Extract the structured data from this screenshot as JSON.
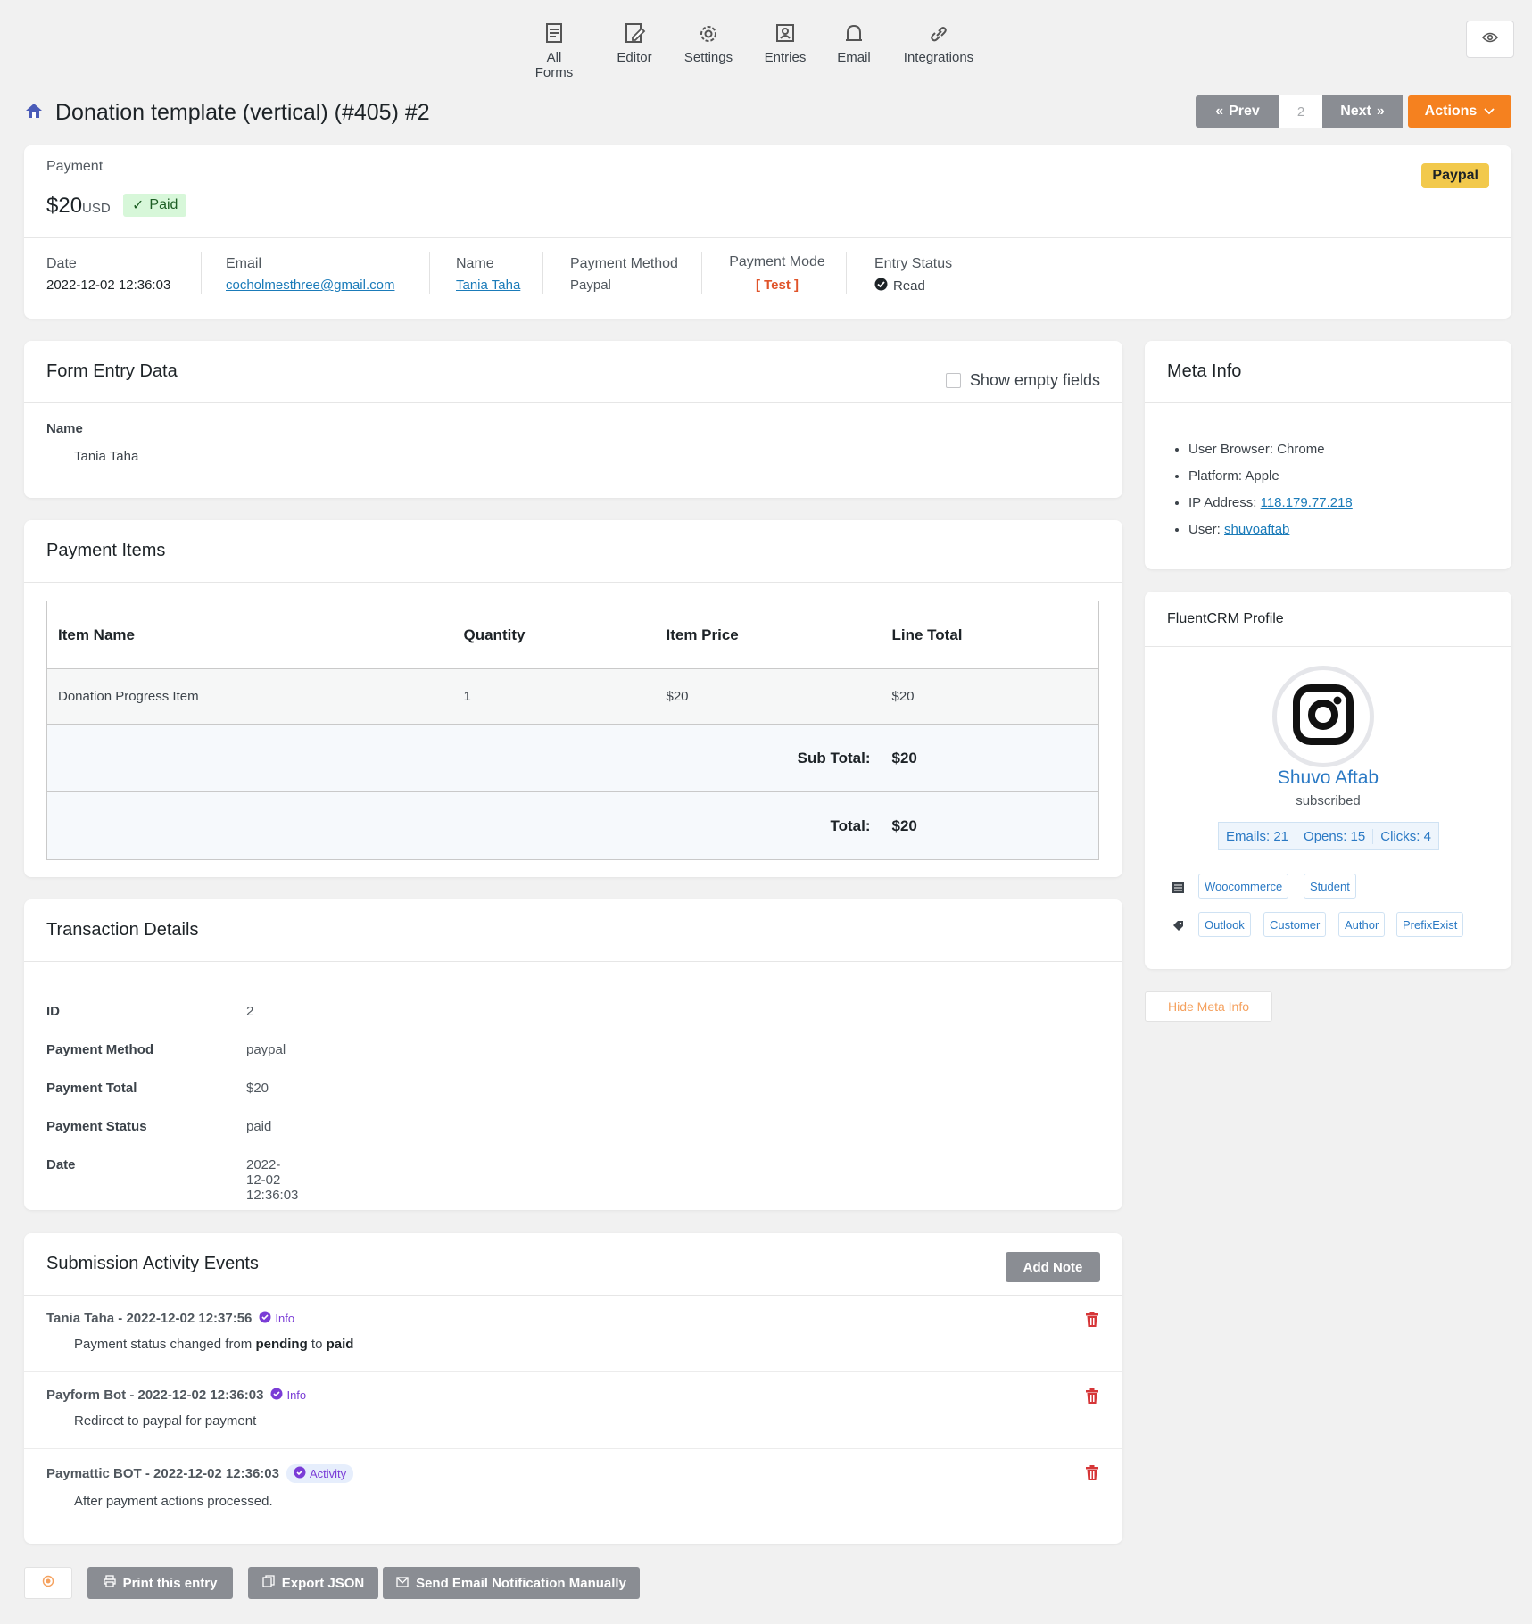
{
  "nav": {
    "items": [
      {
        "label": "All Forms",
        "icon": "document-icon"
      },
      {
        "label": "Editor",
        "icon": "edit-icon"
      },
      {
        "label": "Settings",
        "icon": "gear-icon"
      },
      {
        "label": "Entries",
        "icon": "entries-icon"
      },
      {
        "label": "Email",
        "icon": "bell-icon"
      },
      {
        "label": "Integrations",
        "icon": "link-icon"
      }
    ]
  },
  "header": {
    "title": "Donation template (vertical) (#405) #2",
    "prev_label": "Prev",
    "page": "2",
    "next_label": "Next",
    "actions_label": "Actions"
  },
  "payment": {
    "label": "Payment",
    "amount": "$20",
    "currency": "USD",
    "status": "Paid",
    "gateway_badge": "Paypal",
    "fields": [
      {
        "label": "Date",
        "value": "2022-12-02 12:36:03"
      },
      {
        "label": "Email",
        "value": "cocholmesthree@gmail.com"
      },
      {
        "label": "Name",
        "value": "Tania Taha"
      },
      {
        "label": "Payment Method",
        "value": "Paypal"
      },
      {
        "label": "Payment Mode",
        "value": "[ Test ]"
      },
      {
        "label": "Entry Status",
        "value": "Read"
      }
    ]
  },
  "form_entry": {
    "title": "Form Entry Data",
    "show_empty_label": "Show empty fields",
    "field_label": "Name",
    "field_value": "Tania Taha"
  },
  "payment_items": {
    "title": "Payment Items",
    "columns": [
      "Item Name",
      "Quantity",
      "Item Price",
      "Line Total"
    ],
    "rows": [
      [
        "Donation Progress Item",
        "1",
        "$20",
        "$20"
      ]
    ],
    "subtotal_label": "Sub Total:",
    "subtotal": "$20",
    "total_label": "Total:",
    "total": "$20"
  },
  "transaction": {
    "title": "Transaction Details",
    "rows": [
      {
        "k": "ID",
        "v": "2"
      },
      {
        "k": "Payment Method",
        "v": "paypal"
      },
      {
        "k": "Payment Total",
        "v": "$20"
      },
      {
        "k": "Payment Status",
        "v": "paid"
      },
      {
        "k": "Date",
        "v": "2022-12-02 12:36:03"
      }
    ]
  },
  "activity": {
    "title": "Submission Activity Events",
    "add_note_label": "Add Note",
    "events": [
      {
        "who": "Tania Taha - 2022-12-02 12:37:56",
        "badge": "Info",
        "msg_pre": "Payment status changed from ",
        "msg_b1": "pending",
        "msg_mid": " to ",
        "msg_b2": "paid"
      },
      {
        "who": "Payform Bot - 2022-12-02 12:36:03",
        "badge": "Info",
        "msg": "Redirect to paypal for payment"
      },
      {
        "who": "Paymattic BOT - 2022-12-02 12:36:03",
        "badge": "Activity",
        "msg": "After payment actions processed."
      }
    ]
  },
  "meta": {
    "title": "Meta Info",
    "browser": "User Browser: Chrome",
    "platform": "Platform: Apple",
    "ip_label": "IP Address: ",
    "ip": "118.179.77.218",
    "user_label": "User: ",
    "user": "shuvoaftab"
  },
  "crm": {
    "title": "FluentCRM Profile",
    "name": "Shuvo Aftab",
    "status": "subscribed",
    "emails": "Emails: 21",
    "opens": "Opens: 15",
    "clicks": "Clicks: 4",
    "lists": [
      "Woocommerce",
      "Student"
    ],
    "tags": [
      "Outlook",
      "Customer",
      "Author",
      "PrefixExist"
    ]
  },
  "hide_meta_label": "Hide Meta Info",
  "footer": {
    "print_label": "Print this entry",
    "export_label": "Export JSON",
    "email_label": "Send Email Notification Manually"
  },
  "colors": {
    "accent": "#f5811f",
    "gray_button": "#8a8d93",
    "paid_bg": "#d7f7d9",
    "paypal_badge": "#f2c94c"
  }
}
